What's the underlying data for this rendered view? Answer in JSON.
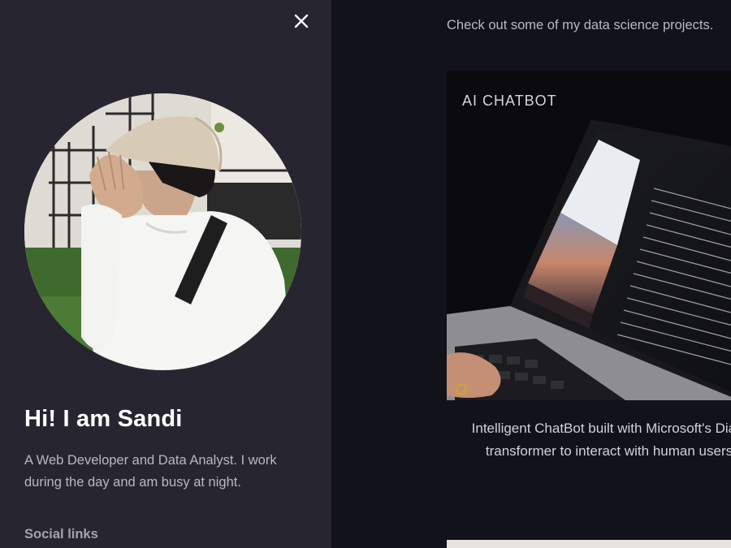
{
  "sidebar": {
    "close_label": "×",
    "greeting": "Hi! I am Sandi",
    "bio": "A Web Developer and Data Analyst. I work during the day and am busy at night.",
    "social_heading": "Social links"
  },
  "main": {
    "intro": "Check out some of my data science projects.",
    "projects": [
      {
        "title": "AI CHATBOT",
        "description_line1": "Intelligent ChatBot built with Microsoft's Dialo",
        "description_line2": "transformer to interact with human users"
      }
    ]
  },
  "icons": {
    "close": "close-icon"
  },
  "colors": {
    "sidebar_bg": "#272630",
    "main_bg": "#11121a",
    "heading_text": "#ffffff",
    "muted_text": "#b8b7c4"
  }
}
